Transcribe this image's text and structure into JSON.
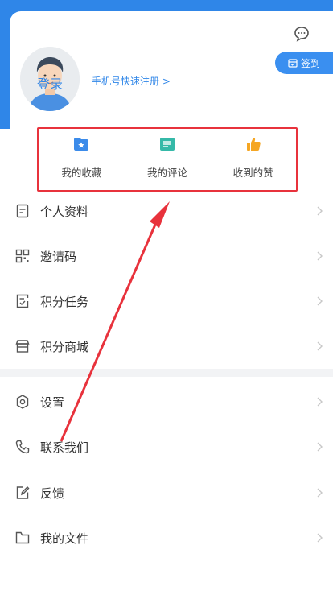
{
  "header": {
    "login_label": "登录",
    "register_label": "手机号快速注册 >",
    "signin_label": "签到"
  },
  "quick_actions": [
    {
      "label": "我的收藏",
      "icon": "favorites-folder-icon",
      "color": "#3b8bea"
    },
    {
      "label": "我的评论",
      "icon": "comment-card-icon",
      "color": "#35b9a8"
    },
    {
      "label": "收到的赞",
      "icon": "thumbs-up-icon",
      "color": "#f5a623"
    }
  ],
  "menu_group_1": [
    {
      "label": "个人资料",
      "icon": "document-icon"
    },
    {
      "label": "邀请码",
      "icon": "qr-code-icon"
    },
    {
      "label": "积分任务",
      "icon": "task-list-icon"
    },
    {
      "label": "积分商城",
      "icon": "store-icon"
    }
  ],
  "menu_group_2": [
    {
      "label": "设置",
      "icon": "settings-icon"
    },
    {
      "label": "联系我们",
      "icon": "phone-icon"
    },
    {
      "label": "反馈",
      "icon": "edit-icon"
    },
    {
      "label": "我的文件",
      "icon": "folder-icon"
    }
  ],
  "colors": {
    "brand_blue": "#2f86e8",
    "highlight_red": "#e8323c"
  }
}
